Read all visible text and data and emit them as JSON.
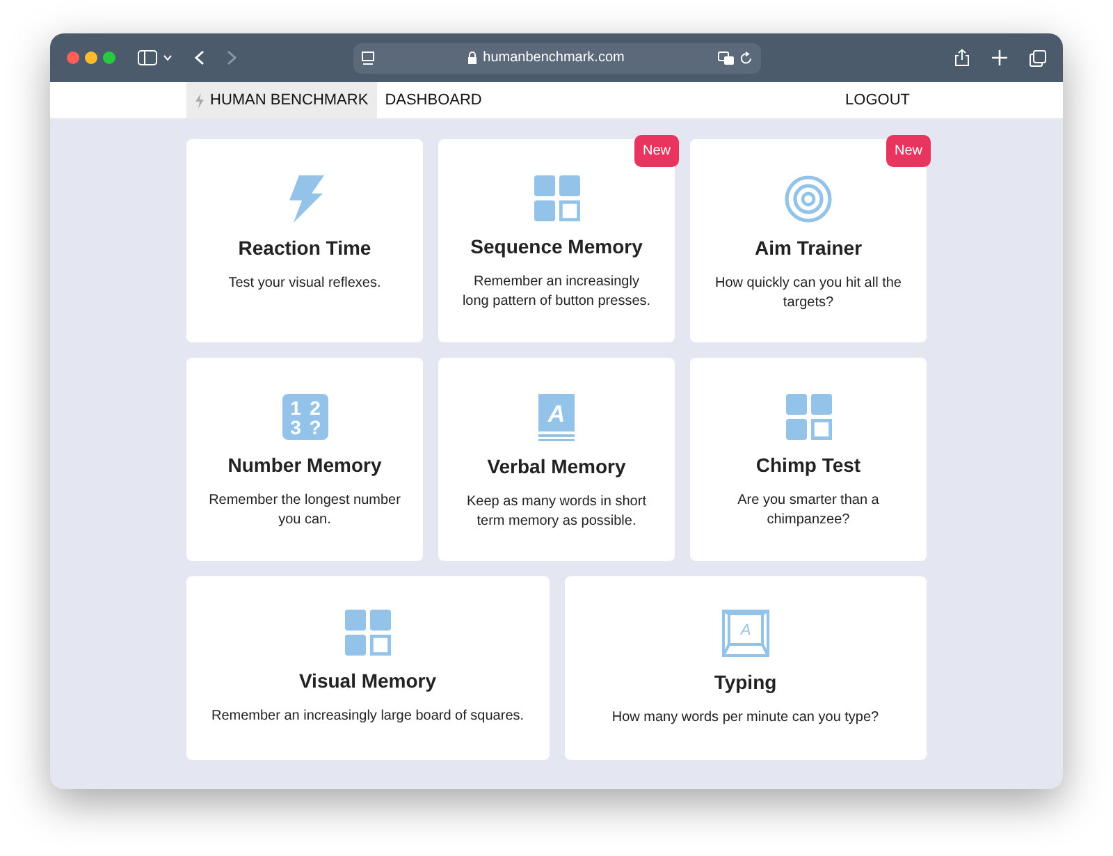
{
  "browser": {
    "url": "humanbenchmark.com"
  },
  "navbar": {
    "brand": "HUMAN BENCHMARK",
    "links": [
      "DASHBOARD"
    ],
    "logout": "LOGOUT"
  },
  "cards": [
    {
      "kind": "bolt",
      "title": "Reaction Time",
      "description": "Test your visual reflexes."
    },
    {
      "kind": "grid",
      "title": "Sequence Memory",
      "description": "Remember an increasingly long pattern of button presses.",
      "badge": "New"
    },
    {
      "kind": "target",
      "title": "Aim Trainer",
      "description": "How quickly can you hit all the targets?",
      "badge": "New"
    },
    {
      "kind": "number",
      "icon_glyphs": [
        "1",
        "2",
        "3",
        "?"
      ],
      "title": "Number Memory",
      "description": "Remember the longest number you can."
    },
    {
      "kind": "book",
      "icon_glyphs": [
        "A"
      ],
      "title": "Verbal Memory",
      "description": "Keep as many words in short term memory as possible."
    },
    {
      "kind": "grid",
      "title": "Chimp Test",
      "description": "Are you smarter than a chimpanzee?"
    },
    {
      "kind": "grid",
      "title": "Visual Memory",
      "description": "Remember an increasingly large board of squares."
    },
    {
      "kind": "key",
      "icon_glyphs": [
        "A"
      ],
      "title": "Typing",
      "description": "How many words per minute can you type?"
    }
  ]
}
